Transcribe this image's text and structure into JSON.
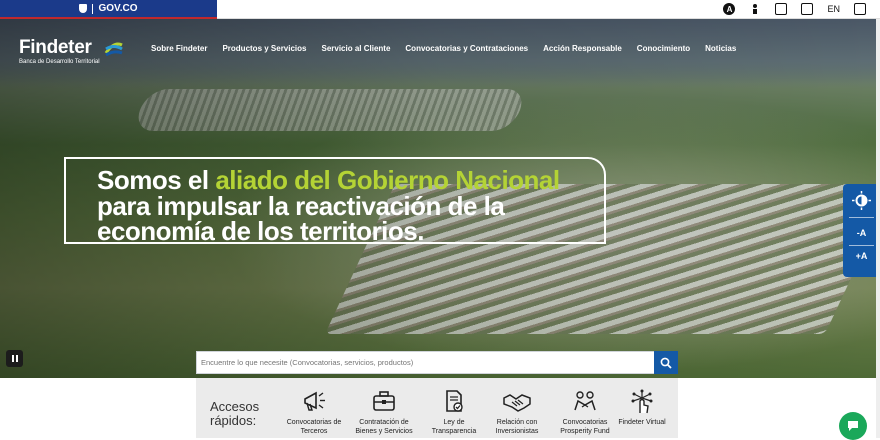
{
  "gov_bar": {
    "label": "GOV.CO"
  },
  "top_tools": {
    "lang": "EN",
    "a_icon": "A"
  },
  "header": {
    "logo_name": "Findeter",
    "logo_sub": "Banca de Desarrollo Territorial",
    "nav": [
      "Sobre Findeter",
      "Productos y Servicios",
      "Servicio al Cliente",
      "Convocatorias y Contrataciones",
      "Acción Responsable",
      "Conocimiento",
      "Noticias"
    ]
  },
  "hero": {
    "line1_a": "Somos el ",
    "line1_b": "aliado del Gobierno Nacional",
    "line2": "para impulsar la reactivación de la",
    "line3": "economía de los territorios."
  },
  "side_tools": {
    "contrast": "",
    "text_smaller": "-A",
    "text_larger": "+A"
  },
  "search": {
    "placeholder": "Encuentre lo que necesite (Convocatorias, servicios, productos)"
  },
  "quick_access": {
    "title": "Accesos rápidos:",
    "items": [
      {
        "label": "Convocatorias de Terceros",
        "icon": "megaphone-icon"
      },
      {
        "label": "Contratación de Bienes y Servicios",
        "icon": "briefcase-icon"
      },
      {
        "label": "Ley de Transparencia",
        "icon": "document-check-icon"
      },
      {
        "label": "Relación con Inversionistas",
        "icon": "handshake-icon"
      },
      {
        "label": "Convocatorias Prosperity Fund",
        "icon": "hands-group-icon"
      },
      {
        "label": "Findeter Virtual",
        "icon": "touch-network-icon"
      }
    ]
  },
  "colors": {
    "gov_blue": "#1b3a8a",
    "brand_blue": "#1459a6",
    "accent_green": "#b4d335",
    "chat_green": "#1aa85a"
  }
}
